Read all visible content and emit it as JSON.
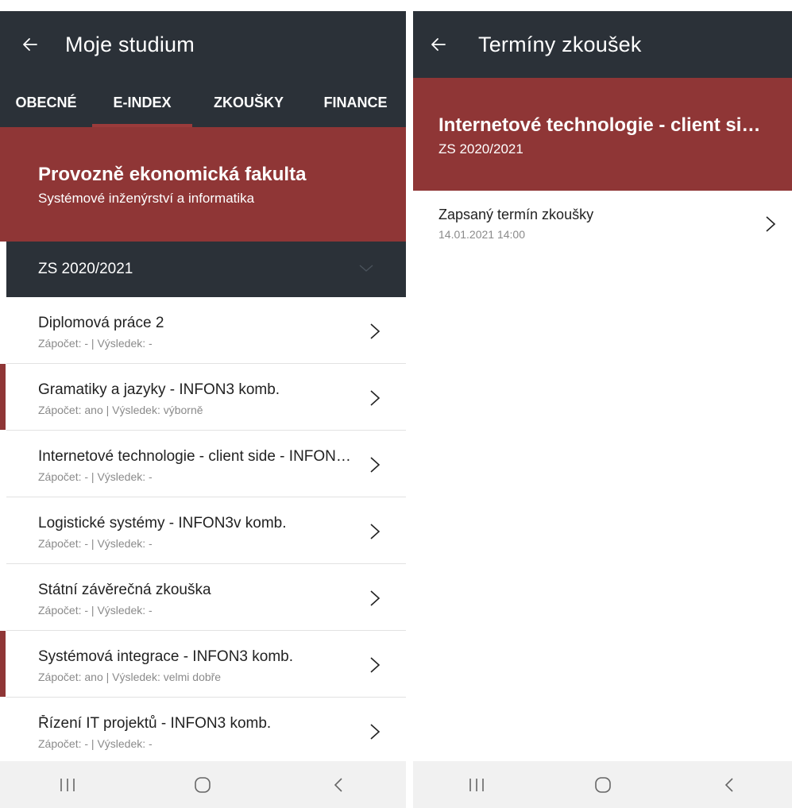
{
  "left": {
    "appbar": {
      "title": "Moje studium"
    },
    "tabs": [
      {
        "label": "OBECNÉ",
        "active": false
      },
      {
        "label": "E-INDEX",
        "active": true
      },
      {
        "label": "ZKOUŠKY",
        "active": false
      },
      {
        "label": "FINANCE",
        "active": false
      }
    ],
    "hero": {
      "title": "Provozně ekonomická fakulta",
      "subtitle": "Systémové inženýrství a informatika"
    },
    "semester": {
      "label": "ZS 2020/2021"
    },
    "courses": [
      {
        "title": "Diplomová práce 2",
        "detail": "Zápočet: - | Výsledek: -",
        "marked": false
      },
      {
        "title": "Gramatiky a jazyky - INFON3 komb.",
        "detail": "Zápočet: ano | Výsledek: výborně",
        "marked": true
      },
      {
        "title": "Internetové technologie - client side - INFON…",
        "detail": "Zápočet: - | Výsledek: -",
        "marked": false
      },
      {
        "title": "Logistické systémy - INFON3v komb.",
        "detail": "Zápočet: - | Výsledek: -",
        "marked": false
      },
      {
        "title": "Státní závěrečná zkouška",
        "detail": "Zápočet: - | Výsledek: -",
        "marked": false
      },
      {
        "title": "Systémová integrace - INFON3 komb.",
        "detail": "Zápočet: ano | Výsledek: velmi dobře",
        "marked": true
      },
      {
        "title": "Řízení IT projektů - INFON3 komb.",
        "detail": "Zápočet: - | Výsledek: -",
        "marked": false
      }
    ]
  },
  "right": {
    "appbar": {
      "title": "Termíny zkoušek"
    },
    "hero": {
      "title": "Internetové technologie - client sid…",
      "subtitle": "ZS 2020/2021"
    },
    "exam": {
      "title": "Zapsaný termín zkoušky",
      "datetime": "14.01.2021 14:00"
    }
  },
  "colors": {
    "appbar": "#2b3138",
    "accent": "#8f3636",
    "navbar": "#f1f1f1"
  },
  "icons": {
    "back": "arrow-left-icon",
    "chevron": "chevron-right-icon",
    "recents": "recents-icon",
    "home": "home-icon",
    "nav_back": "nav-back-icon"
  }
}
